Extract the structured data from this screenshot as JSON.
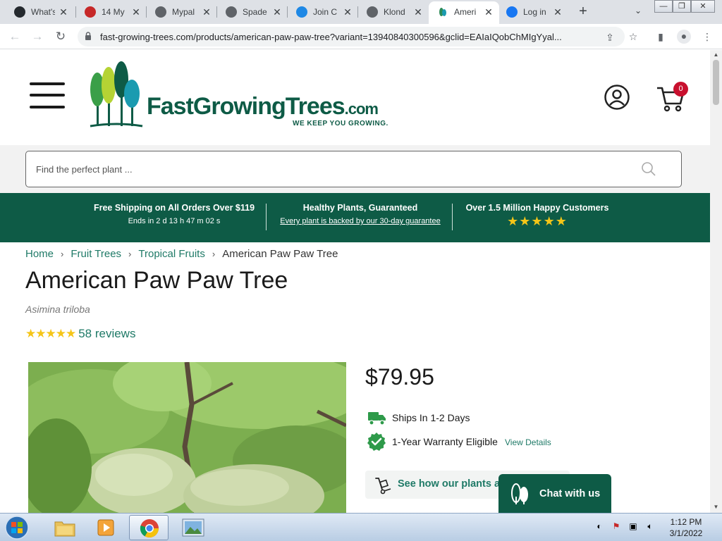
{
  "browser": {
    "tabs": [
      {
        "title": "What's",
        "icon": "github-icon"
      },
      {
        "title": "14 My",
        "icon": "site-icon"
      },
      {
        "title": "Mypal",
        "icon": "globe-icon"
      },
      {
        "title": "Spade",
        "icon": "globe-icon"
      },
      {
        "title": "Join C",
        "icon": "s-icon"
      },
      {
        "title": "Klond",
        "icon": "globe-icon"
      },
      {
        "title": "Ameri",
        "icon": "fgt-icon"
      },
      {
        "title": "Log in",
        "icon": "facebook-icon"
      }
    ],
    "active_tab_index": 6,
    "url": "fast-growing-trees.com/products/american-paw-paw-tree?variant=13940840300596&gclid=EAIaIQobChMIgYyal..."
  },
  "site": {
    "logo_name": "FastGrowingTrees",
    "logo_domain": ".com",
    "logo_tagline": "WE KEEP YOU GROWING.",
    "cart_count": "0",
    "search_placeholder": "Find the perfect plant ...",
    "promo": [
      {
        "heading": "Free Shipping on All Orders Over $119",
        "sub": "Ends in 2 d 13 h 47 m 02 s"
      },
      {
        "heading": "Healthy Plants, Guaranteed",
        "sub": "Every plant is backed by our 30-day guarantee"
      },
      {
        "heading": "Over 1.5 Million Happy Customers",
        "stars": "★★★★★"
      }
    ],
    "brand_color": "#0e5b46",
    "accent_color": "#1f7a67",
    "star_color": "#f5c518"
  },
  "breadcrumb": {
    "items": [
      "Home",
      "Fruit Trees",
      "Tropical Fruits"
    ],
    "current": "American Paw Paw Tree"
  },
  "product": {
    "title": "American Paw Paw Tree",
    "latin_name": "Asimina triloba",
    "stars": "★★★★★",
    "reviews": "58 reviews",
    "price": "$79.95",
    "ships": "Ships In 1-2 Days",
    "warranty": "1-Year Warranty Eligible",
    "view_details": "View Details",
    "see_how": "See how our plants a"
  },
  "chat": {
    "label": "Chat with us"
  },
  "taskbar": {
    "time": "1:12 PM",
    "date": "3/1/2022"
  }
}
